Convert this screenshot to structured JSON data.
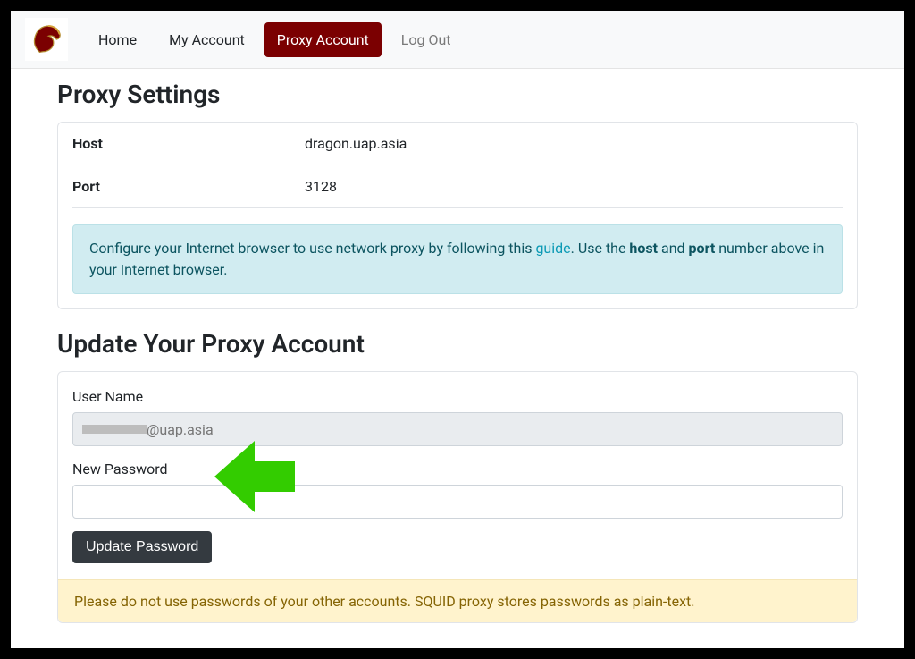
{
  "nav": {
    "home": "Home",
    "my_account": "My Account",
    "proxy_account": "Proxy Account",
    "logout": "Log Out"
  },
  "proxy_settings": {
    "title": "Proxy Settings",
    "host_label": "Host",
    "host_value": "dragon.uap.asia",
    "port_label": "Port",
    "port_value": "3128",
    "info_pre": "Configure your Internet browser to use network proxy by following this ",
    "info_link": "guide",
    "info_mid1": ". Use the ",
    "info_host": "host",
    "info_mid2": " and ",
    "info_port": "port",
    "info_post": " number above in your Internet browser."
  },
  "update": {
    "title": "Update Your Proxy Account",
    "username_label": "User Name",
    "username_domain": "@uap.asia",
    "newpw_label": "New Password",
    "newpw_value": "",
    "button": "Update Password",
    "warning": "Please do not use passwords of your other accounts. SQUID proxy stores passwords as plain-text."
  }
}
